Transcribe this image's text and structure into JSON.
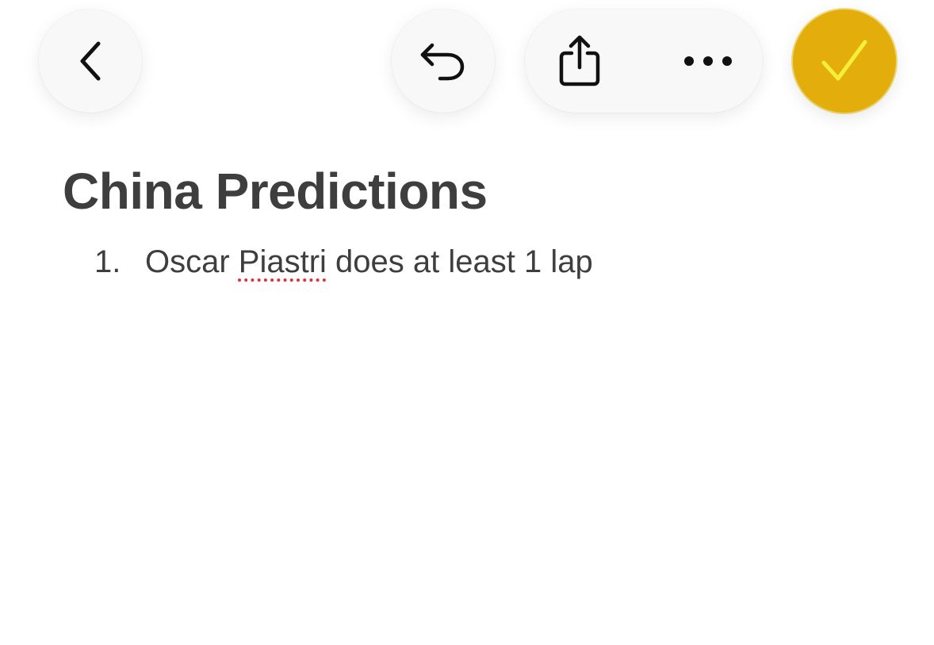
{
  "toolbar": {
    "back_icon": "chevron-left-icon",
    "undo_icon": "undo-icon",
    "share_icon": "share-icon",
    "more_icon": "ellipsis-icon",
    "done_icon": "checkmark-icon",
    "accent_color": "#e3ad0b",
    "checkmark_color": "#f6ef3a"
  },
  "note": {
    "title": "China Predictions",
    "items": [
      {
        "number": "1.",
        "text_before": "Oscar ",
        "misspelled_word": "Piastri",
        "text_after": " does at least 1 lap"
      }
    ]
  }
}
